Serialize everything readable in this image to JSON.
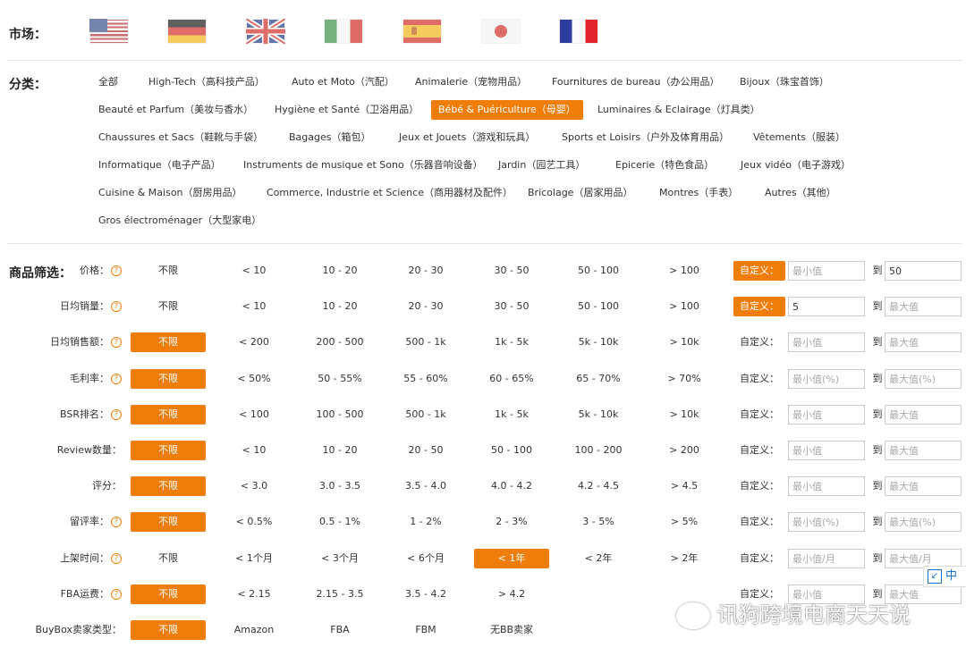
{
  "market": {
    "label": "市场：",
    "flags": [
      "us-flag-icon",
      "de-flag-icon",
      "uk-flag-icon",
      "it-flag-icon",
      "es-flag-icon",
      "jp-flag-icon",
      "fr-flag-icon"
    ]
  },
  "category": {
    "label": "分类：",
    "items": [
      "全部",
      "High-Tech（高科技产品）",
      "Auto et Moto（汽配）",
      "Animalerie（宠物用品）",
      "Fournitures de bureau（办公用品）",
      "Bijoux（珠宝首饰）",
      "Beauté et Parfum（美妆与香水）",
      "Hygiène et Santé（卫浴用品）",
      "Bébé & Puériculture（母婴）",
      "Luminaires & Eclairage（灯具类）",
      "Chaussures et Sacs（鞋靴与手袋）",
      "Bagages（箱包）",
      "Jeux et Jouets（游戏和玩具）",
      "Sports et Loisirs（户外及体育用品）",
      "Vêtements（服装）",
      "Informatique（电子产品）",
      "Instruments de musique et Sono（乐器音响设备）",
      "Jardin（园艺工具）",
      "Epicerie（特色食品）",
      "Jeux vidéo（电子游戏）",
      "Cuisine & Maison（厨房用品）",
      "Commerce, Industrie et Science（商用器材及配件）",
      "Bricolage（居家用品）",
      "Montres（手表）",
      "Autres（其他）",
      "Gros électroménager（大型家电）"
    ],
    "active": "Bébé & Puériculture（母婴）"
  },
  "filter": {
    "label": "商品筛选：",
    "to": "到",
    "custom_label": "自定义：",
    "rows": [
      {
        "label": "价格：",
        "help": "?",
        "options": [
          "不限",
          "< 10",
          "10 - 20",
          "20 - 30",
          "30 - 50",
          "50 - 100",
          "> 100"
        ],
        "active_option": null,
        "custom_active": true,
        "min_placeholder": "最小值",
        "max_placeholder": "最大值",
        "min_value": "",
        "max_value": "50"
      },
      {
        "label": "日均销量：",
        "help": "?",
        "options": [
          "不限",
          "< 10",
          "10 - 20",
          "20 - 30",
          "30 - 50",
          "50 - 100",
          "> 100"
        ],
        "active_option": null,
        "custom_active": true,
        "min_placeholder": "最小值",
        "max_placeholder": "最大值",
        "min_value": "5",
        "max_value": ""
      },
      {
        "label": "日均销售额：",
        "help": "?",
        "options": [
          "不限",
          "< 200",
          "200 - 500",
          "500 - 1k",
          "1k - 5k",
          "5k - 10k",
          "> 10k"
        ],
        "active_option": "不限",
        "custom_active": false,
        "min_placeholder": "最小值",
        "max_placeholder": "最大值",
        "min_value": "",
        "max_value": ""
      },
      {
        "label": "毛利率：",
        "help": "?",
        "options": [
          "不限",
          "< 50%",
          "50 - 55%",
          "55 - 60%",
          "60 - 65%",
          "65 - 70%",
          "> 70%"
        ],
        "active_option": "不限",
        "custom_active": false,
        "min_placeholder": "最小值(%)",
        "max_placeholder": "最大值(%)",
        "min_value": "",
        "max_value": ""
      },
      {
        "label": "BSR排名：",
        "help": "?",
        "options": [
          "不限",
          "< 100",
          "100 - 500",
          "500 - 1k",
          "1k - 5k",
          "5k - 10k",
          "> 10k"
        ],
        "active_option": "不限",
        "custom_active": false,
        "min_placeholder": "最小值",
        "max_placeholder": "最大值",
        "min_value": "",
        "max_value": ""
      },
      {
        "label": "Review数量：",
        "help": "",
        "options": [
          "不限",
          "< 10",
          "10 - 20",
          "20 - 50",
          "50 - 100",
          "100 - 200",
          "> 200"
        ],
        "active_option": "不限",
        "custom_active": false,
        "min_placeholder": "最小值",
        "max_placeholder": "最大值",
        "min_value": "",
        "max_value": ""
      },
      {
        "label": "评分：",
        "help": "",
        "options": [
          "不限",
          "< 3.0",
          "3.0 - 3.5",
          "3.5 - 4.0",
          "4.0 - 4.2",
          "4.2 - 4.5",
          "> 4.5"
        ],
        "active_option": "不限",
        "custom_active": false,
        "min_placeholder": "最小值",
        "max_placeholder": "最大值",
        "min_value": "",
        "max_value": ""
      },
      {
        "label": "留评率：",
        "help": "?",
        "options": [
          "不限",
          "< 0.5%",
          "0.5 - 1%",
          "1 - 2%",
          "2 - 3%",
          "3 - 5%",
          "> 5%"
        ],
        "active_option": "不限",
        "custom_active": false,
        "min_placeholder": "最小值(%)",
        "max_placeholder": "最大值(%)",
        "min_value": "",
        "max_value": ""
      },
      {
        "label": "上架时间：",
        "help": "?",
        "options": [
          "不限",
          "< 1个月",
          "< 3个月",
          "< 6个月",
          "< 1年",
          "< 2年",
          "> 2年"
        ],
        "active_option": "< 1年",
        "custom_active": false,
        "min_placeholder": "最小值/月",
        "max_placeholder": "最大值/月",
        "min_value": "",
        "max_value": ""
      },
      {
        "label": "FBA运费：",
        "help": "?",
        "options": [
          "不限",
          "< 2.15",
          "2.15 - 3.5",
          "3.5 - 4.2",
          "> 4.2"
        ],
        "active_option": "不限",
        "custom_active": false,
        "min_placeholder": "最小值",
        "max_placeholder": "最大值",
        "min_value": "",
        "max_value": ""
      },
      {
        "label": "BuyBox卖家类型：",
        "help": "",
        "options": [
          "不限",
          "Amazon",
          "FBA",
          "FBM",
          "无BB卖家"
        ],
        "active_option": "不限",
        "custom_active": null,
        "min_placeholder": "",
        "max_placeholder": "",
        "min_value": "",
        "max_value": ""
      }
    ]
  },
  "widget": {
    "label": "中",
    "icon": "expand-icon"
  },
  "watermark": {
    "text": "讯狗跨境电商天天说",
    "icon": "wechat-icon"
  }
}
